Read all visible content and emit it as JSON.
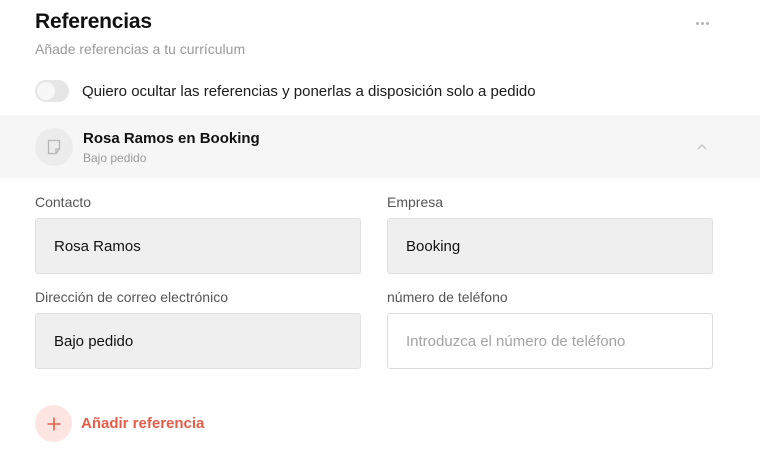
{
  "header": {
    "title": "Referencias",
    "subtitle": "Añade referencias a tu currículum",
    "more_icon": "more-horizontal-icon"
  },
  "toggle": {
    "label": "Quiero ocultar las referencias y ponerlas a disposición solo a pedido",
    "checked": false
  },
  "reference": {
    "title": "Rosa Ramos en Booking",
    "subtitle": "Bajo pedido",
    "icon": "document-icon",
    "collapse_icon": "chevron-up-icon"
  },
  "form": {
    "contact_label": "Contacto",
    "contact_value": "Rosa Ramos",
    "company_label": "Empresa",
    "company_value": "Booking",
    "email_label": "Dirección de correo electrónico",
    "email_value": "Bajo pedido",
    "phone_label": "número de teléfono",
    "phone_value": "",
    "phone_placeholder": "Introduzca el número de teléfono"
  },
  "add_button": {
    "label": "Añadir referencia",
    "icon": "plus-icon"
  },
  "colors": {
    "accent": "#e75c49",
    "accent_bg": "#fde5e1",
    "field_bg": "#efefef",
    "card_bg": "#f6f6f6"
  }
}
